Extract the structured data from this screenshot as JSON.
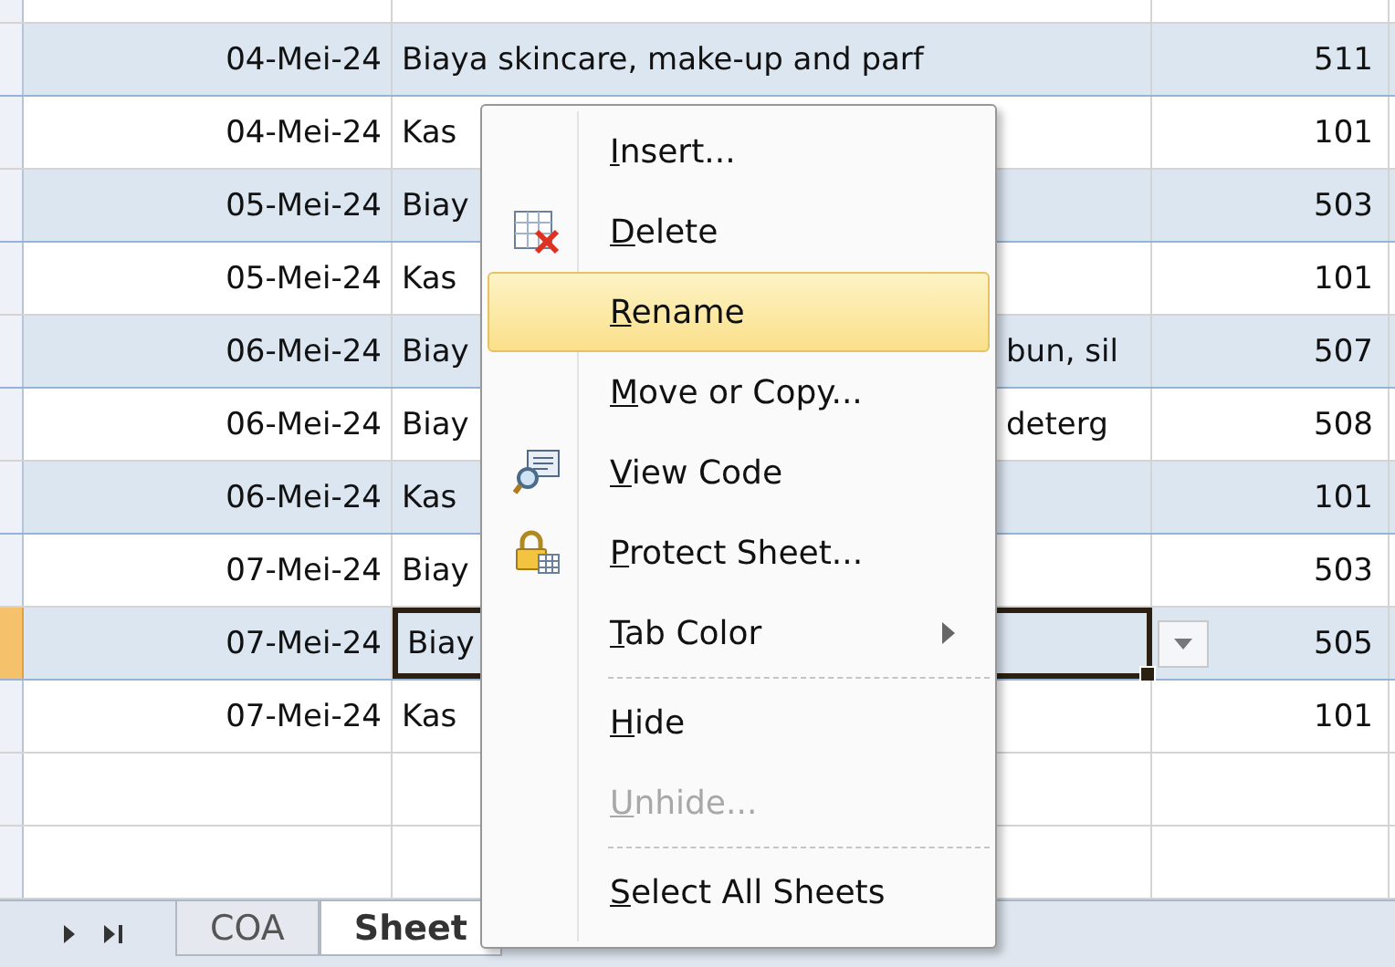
{
  "rows": [
    {
      "date": "04-Mei-24",
      "desc": "Biaya skincare, make-up and parf",
      "desc_right": "",
      "code": "511",
      "selected": false
    },
    {
      "date": "04-Mei-24",
      "desc": "Kas",
      "desc_right": "",
      "code": "101",
      "selected": false
    },
    {
      "date": "05-Mei-24",
      "desc": "Biay",
      "desc_right": "",
      "code": "503",
      "selected": false
    },
    {
      "date": "05-Mei-24",
      "desc": "Kas",
      "desc_right": "",
      "code": "101",
      "selected": false
    },
    {
      "date": "06-Mei-24",
      "desc": "Biay",
      "desc_right": "bun, sil",
      "code": "507",
      "selected": false
    },
    {
      "date": "06-Mei-24",
      "desc": "Biay",
      "desc_right": "deterg",
      "code": "508",
      "selected": false
    },
    {
      "date": "06-Mei-24",
      "desc": "Kas",
      "desc_right": "",
      "code": "101",
      "selected": false
    },
    {
      "date": "07-Mei-24",
      "desc": "Biay",
      "desc_right": "",
      "code": "503",
      "selected": false
    },
    {
      "date": "07-Mei-24",
      "desc": "Biay",
      "desc_right": "",
      "code": "505",
      "selected": true
    },
    {
      "date": "07-Mei-24",
      "desc": "Kas",
      "desc_right": "",
      "code": "101",
      "selected": false
    }
  ],
  "sheet_tabs": [
    {
      "label": "COA",
      "selected": false
    },
    {
      "label": "Sheet",
      "selected": true
    }
  ],
  "context_menu": [
    {
      "kind": "plain",
      "label": "Insert...",
      "selected": false,
      "disabled": false
    },
    {
      "kind": "icon-delete",
      "label": "Delete",
      "selected": false,
      "disabled": false
    },
    {
      "kind": "plain",
      "label": "Rename",
      "selected": true,
      "disabled": false
    },
    {
      "kind": "plain",
      "label": "Move or Copy...",
      "selected": false,
      "disabled": false
    },
    {
      "kind": "icon-code",
      "label": "View Code",
      "selected": false,
      "disabled": false
    },
    {
      "kind": "icon-lock",
      "label": "Protect Sheet...",
      "selected": false,
      "disabled": false
    },
    {
      "kind": "submenu",
      "label": "Tab Color",
      "selected": false,
      "disabled": false
    },
    {
      "kind": "separator"
    },
    {
      "kind": "plain",
      "label": "Hide",
      "selected": false,
      "disabled": false
    },
    {
      "kind": "plain",
      "label": "Unhide...",
      "selected": false,
      "disabled": true
    },
    {
      "kind": "separator"
    },
    {
      "kind": "plain",
      "label": "Select All Sheets",
      "selected": false,
      "disabled": false
    }
  ]
}
